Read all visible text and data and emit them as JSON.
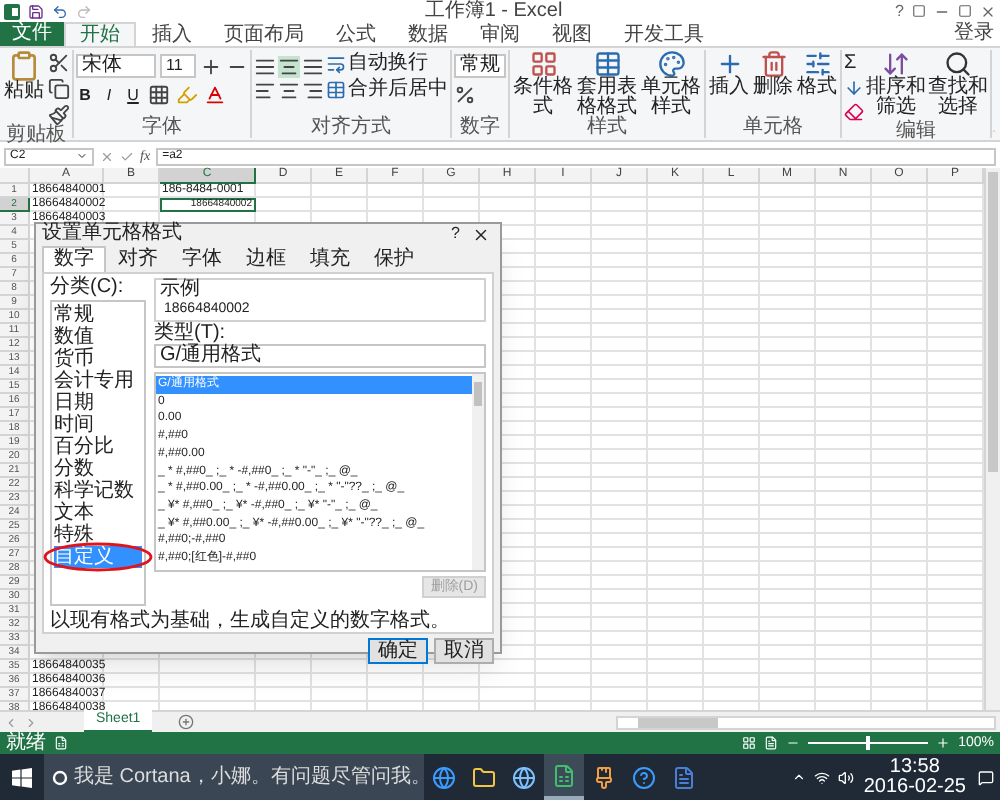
{
  "window": {
    "title": "工作簿1 - Excel",
    "help": "?"
  },
  "ribbon_tabs": [
    {
      "label": "文件",
      "kind": "file",
      "selected": false
    },
    {
      "label": "开始",
      "kind": "tab",
      "selected": true
    },
    {
      "label": "插入",
      "kind": "tab",
      "selected": false
    },
    {
      "label": "页面布局",
      "kind": "tab",
      "selected": false
    },
    {
      "label": "公式",
      "kind": "tab",
      "selected": false
    },
    {
      "label": "数据",
      "kind": "tab",
      "selected": false
    },
    {
      "label": "审阅",
      "kind": "tab",
      "selected": false
    },
    {
      "label": "视图",
      "kind": "tab",
      "selected": false
    },
    {
      "label": "开发工具",
      "kind": "tab",
      "selected": false
    }
  ],
  "sign_in": "登录",
  "ribbon_groups": [
    {
      "kind": "clipboard",
      "label": "剪贴板",
      "buttons": [
        "粘贴"
      ]
    },
    {
      "kind": "font",
      "label": "字体",
      "font": "宋体",
      "size": "11",
      "styles": [
        "B",
        "I",
        "U"
      ]
    },
    {
      "kind": "alignment",
      "label": "对齐方式",
      "buttons": [
        "自动换行",
        "合并后居中"
      ]
    },
    {
      "kind": "number",
      "label": "数字",
      "format": "常规"
    },
    {
      "kind": "styles",
      "label": "样式",
      "buttons": [
        "条件格式",
        "套用表格格式",
        "单元格样式"
      ]
    },
    {
      "kind": "cells",
      "label": "单元格",
      "buttons": [
        "插入",
        "删除",
        "格式"
      ]
    },
    {
      "kind": "editing",
      "label": "编辑",
      "sigma": "Σ",
      "buttons": [
        "排序和筛选",
        "查找和选择"
      ]
    }
  ],
  "formula_bar": {
    "name_box": "C2",
    "fx": "fx",
    "formula": "=a2"
  },
  "columns": [
    {
      "label": "A",
      "selected": false
    },
    {
      "label": "B",
      "selected": false
    },
    {
      "label": "C",
      "selected": true
    },
    {
      "label": "D",
      "selected": false
    },
    {
      "label": "E",
      "selected": false
    },
    {
      "label": "F",
      "selected": false
    },
    {
      "label": "G",
      "selected": false
    },
    {
      "label": "H",
      "selected": false
    },
    {
      "label": "I",
      "selected": false
    },
    {
      "label": "J",
      "selected": false
    },
    {
      "label": "K",
      "selected": false
    },
    {
      "label": "L",
      "selected": false
    },
    {
      "label": "M",
      "selected": false
    },
    {
      "label": "N",
      "selected": false
    },
    {
      "label": "O",
      "selected": false
    },
    {
      "label": "P",
      "selected": false
    }
  ],
  "rows": [
    {
      "number": "1",
      "selected": false,
      "cells": [
        {
          "text": "18664840001",
          "kind": "text",
          "active": false
        },
        {
          "kind": "empty"
        },
        {
          "text": "186-8484-0001",
          "kind": "text",
          "active": false
        }
      ]
    },
    {
      "number": "2",
      "selected": true,
      "cells": [
        {
          "text": "18664840002",
          "kind": "text",
          "active": false
        },
        {
          "kind": "empty"
        },
        {
          "text": "18664840002",
          "kind": "number",
          "active": true
        }
      ]
    },
    {
      "number": "3",
      "selected": false,
      "cells": [
        {
          "text": "18664840003",
          "kind": "text",
          "active": false
        }
      ]
    },
    {
      "number": "4",
      "selected": false
    },
    {
      "number": "5",
      "selected": false
    },
    {
      "number": "6",
      "selected": false
    },
    {
      "number": "7",
      "selected": false
    },
    {
      "number": "8",
      "selected": false
    },
    {
      "number": "9",
      "selected": false
    },
    {
      "number": "10",
      "selected": false
    },
    {
      "number": "11",
      "selected": false
    },
    {
      "number": "12",
      "selected": false
    },
    {
      "number": "13",
      "selected": false
    },
    {
      "number": "14",
      "selected": false
    },
    {
      "number": "15",
      "selected": false
    },
    {
      "number": "16",
      "selected": false
    },
    {
      "number": "17",
      "selected": false
    },
    {
      "number": "18",
      "selected": false
    },
    {
      "number": "19",
      "selected": false
    },
    {
      "number": "20",
      "selected": false
    },
    {
      "number": "21",
      "selected": false
    },
    {
      "number": "22",
      "selected": false
    },
    {
      "number": "23",
      "selected": false
    },
    {
      "number": "24",
      "selected": false
    },
    {
      "number": "25",
      "selected": false
    },
    {
      "number": "26",
      "selected": false
    },
    {
      "number": "27",
      "selected": false
    },
    {
      "number": "28",
      "selected": false
    },
    {
      "number": "29",
      "selected": false
    },
    {
      "number": "30",
      "selected": false
    },
    {
      "number": "31",
      "selected": false
    },
    {
      "number": "32",
      "selected": false
    },
    {
      "number": "33",
      "selected": false
    },
    {
      "number": "34",
      "selected": false
    },
    {
      "number": "35",
      "selected": false,
      "cells": [
        {
          "text": "18664840035",
          "kind": "text",
          "active": false
        }
      ]
    },
    {
      "number": "36",
      "selected": false,
      "cells": [
        {
          "text": "18664840036",
          "kind": "text",
          "active": false
        }
      ]
    },
    {
      "number": "37",
      "selected": false,
      "cells": [
        {
          "text": "18664840037",
          "kind": "text",
          "active": false
        }
      ]
    },
    {
      "number": "38",
      "selected": false,
      "cells": [
        {
          "text": "18664840038",
          "kind": "text",
          "active": false
        }
      ]
    }
  ],
  "dialog": {
    "title": "设置单元格格式",
    "help": "?",
    "tabs": [
      {
        "label": "数字",
        "selected": true
      },
      {
        "label": "对齐",
        "selected": false
      },
      {
        "label": "字体",
        "selected": false
      },
      {
        "label": "边框",
        "selected": false
      },
      {
        "label": "填充",
        "selected": false
      },
      {
        "label": "保护",
        "selected": false
      }
    ],
    "category_label": "分类(C):",
    "categories": [
      {
        "label": "常规",
        "selected": false
      },
      {
        "label": "数值",
        "selected": false
      },
      {
        "label": "货币",
        "selected": false
      },
      {
        "label": "会计专用",
        "selected": false
      },
      {
        "label": "日期",
        "selected": false
      },
      {
        "label": "时间",
        "selected": false
      },
      {
        "label": "百分比",
        "selected": false
      },
      {
        "label": "分数",
        "selected": false
      },
      {
        "label": "科学记数",
        "selected": false
      },
      {
        "label": "文本",
        "selected": false
      },
      {
        "label": "特殊",
        "selected": false
      },
      {
        "label": "自定义",
        "selected": true
      }
    ],
    "sample_label": "示例",
    "sample": "18664840002",
    "type_label": "类型(T):",
    "type_value": "G/通用格式",
    "types": [
      {
        "label": "G/通用格式",
        "selected": true
      },
      {
        "label": "0",
        "selected": false
      },
      {
        "label": "0.00",
        "selected": false
      },
      {
        "label": "#,##0",
        "selected": false
      },
      {
        "label": "#,##0.00",
        "selected": false
      },
      {
        "label": "_ * #,##0_ ;_ * -#,##0_ ;_ * \"-\"_ ;_ @_",
        "selected": false
      },
      {
        "label": "_ * #,##0.00_ ;_ * -#,##0.00_ ;_ * \"-\"??_ ;_ @_",
        "selected": false
      },
      {
        "label": "_ ¥* #,##0_ ;_ ¥* -#,##0_ ;_ ¥* \"-\"_ ;_ @_",
        "selected": false
      },
      {
        "label": "_ ¥* #,##0.00_ ;_ ¥* -#,##0.00_ ;_ ¥* \"-\"??_ ;_ @_",
        "selected": false
      },
      {
        "label": "#,##0;-#,##0",
        "selected": false
      },
      {
        "label": "#,##0;[红色]-#,##0",
        "selected": false
      }
    ],
    "delete_button": {
      "label": "删除(D)",
      "disabled": true
    },
    "description": "以现有格式为基础，生成自定义的数字格式。",
    "buttons": [
      {
        "label": "确定",
        "default": true
      },
      {
        "label": "取消",
        "default": false
      }
    ]
  },
  "sheet_tabs": [
    {
      "label": "Sheet1",
      "selected": true
    }
  ],
  "status_bar": {
    "status": "就绪",
    "zoom": "100%",
    "zoom_slider": {
      "level": 0.5
    }
  },
  "taskbar": {
    "search_placeholder": "我是 Cortana，小娜。有问题尽管问我。",
    "time": "13:58",
    "date": "2016-02-25"
  }
}
